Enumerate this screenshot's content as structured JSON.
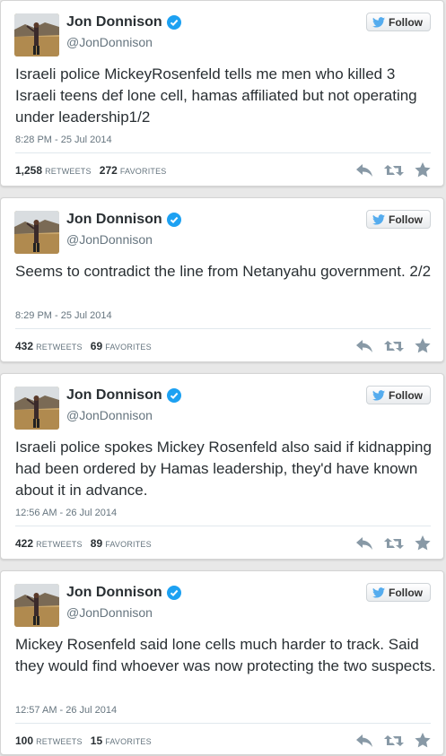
{
  "tweets": [
    {
      "name": "Jon Donnison",
      "handle": "@JonDonnison",
      "follow_label": "Follow",
      "text": "Israeli police MickeyRosenfeld tells me men who killed 3 Israeli teens def lone cell, hamas affiliated but not operating under leadership1/2",
      "timestamp": "8:28 PM - 25 Jul 2014",
      "retweets": "1,258",
      "retweets_label": "RETWEETS",
      "favorites": "272",
      "favorites_label": "FAVORITES"
    },
    {
      "name": "Jon Donnison",
      "handle": "@JonDonnison",
      "follow_label": "Follow",
      "text": "Seems to contradict the line from Netanyahu government. 2/2",
      "timestamp": "8:29 PM - 25 Jul 2014",
      "retweets": "432",
      "retweets_label": "RETWEETS",
      "favorites": "69",
      "favorites_label": "FAVORITES"
    },
    {
      "name": "Jon Donnison",
      "handle": "@JonDonnison",
      "follow_label": "Follow",
      "text": "Israeli police spokes Mickey Rosenfeld also said if kidnapping had been ordered by Hamas leadership, they'd have known about it in advance.",
      "timestamp": "12:56 AM - 26 Jul 2014",
      "retweets": "422",
      "retweets_label": "RETWEETS",
      "favorites": "89",
      "favorites_label": "FAVORITES"
    },
    {
      "name": "Jon Donnison",
      "handle": "@JonDonnison",
      "follow_label": "Follow",
      "text": "Mickey Rosenfeld said lone cells much harder to track. Said they would find whoever was now protecting the two suspects.",
      "timestamp": "12:57 AM - 26 Jul 2014",
      "retweets": "100",
      "retweets_label": "RETWEETS",
      "favorites": "15",
      "favorites_label": "FAVORITES"
    }
  ],
  "colors": {
    "verified": "#1da1f2",
    "bird": "#55acee",
    "action_icons": "#8899a6"
  },
  "icons": {
    "verified": "verified-badge-icon",
    "follow": "twitter-bird-icon",
    "reply": "reply-icon",
    "retweet": "retweet-icon",
    "favorite": "star-icon"
  }
}
